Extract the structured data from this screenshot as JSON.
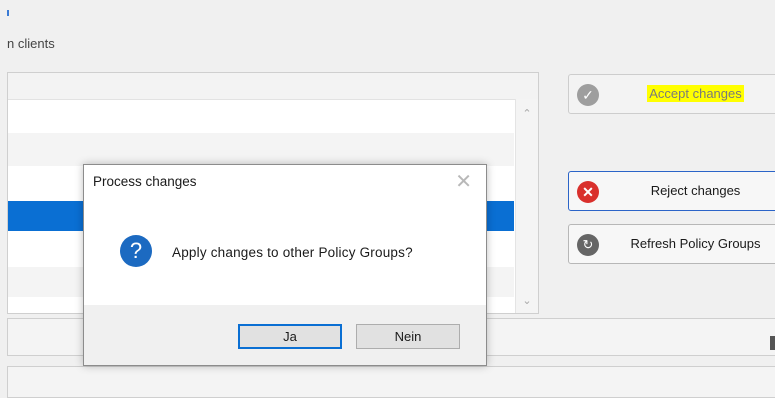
{
  "page": {
    "subtitle": "n clients"
  },
  "actions": {
    "accept": {
      "label": "Accept changes",
      "icon": "check-circle-icon"
    },
    "reject": {
      "label": "Reject changes",
      "icon": "x-circle-icon"
    },
    "refresh": {
      "label": "Refresh Policy Groups",
      "icon": "refresh-icon"
    }
  },
  "dialog": {
    "title": "Process changes",
    "message": "Apply changes to other Policy Groups?",
    "icon": "question-icon",
    "buttons": {
      "yes": "Ja",
      "no": "Nein"
    }
  },
  "colors": {
    "selection": "#0a6fd3",
    "highlight": "#ffff00",
    "reject_icon": "#d9302c",
    "question_icon": "#1c6ac1"
  }
}
